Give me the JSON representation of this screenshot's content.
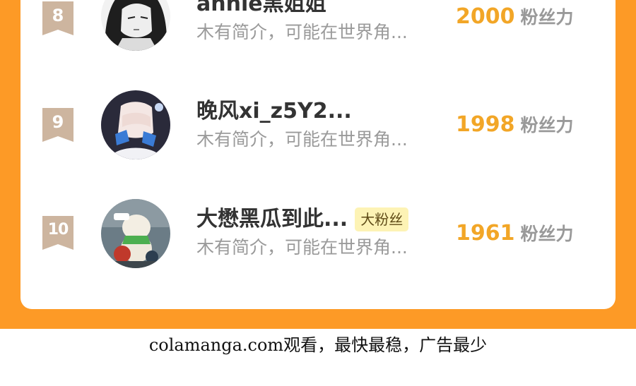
{
  "colors": {
    "page_background": "#fd9a26",
    "card_background": "#ffffff",
    "rank_badge": "#cdb59f",
    "score_color": "#f2a627",
    "name_color": "#333333",
    "bio_color": "#9a9a9a",
    "fan_badge_bg": "#fdf3b5"
  },
  "leaderboard": {
    "rows": [
      {
        "rank": "8",
        "name": "annie黑姐姐",
        "bio": "木有简介，可能在世界角...",
        "score": "2000",
        "score_unit": "粉丝力",
        "avatar_icon": "avatar-dark-hair-anime-girl"
      },
      {
        "rank": "9",
        "name": "晚风xi_z5Y2...",
        "bio": "木有简介，可能在世界角...",
        "score": "1998",
        "score_unit": "粉丝力",
        "avatar_icon": "avatar-anime-girl-covering-face"
      },
      {
        "rank": "10",
        "name": "大懋黑瓜到此...",
        "badge": "大粉丝",
        "bio": "木有简介，可能在世界角...",
        "score": "1961",
        "score_unit": "粉丝力",
        "avatar_icon": "avatar-figurine-toy"
      }
    ]
  },
  "footer": {
    "text": "colamanga.com观看，最快最稳，广告最少"
  }
}
